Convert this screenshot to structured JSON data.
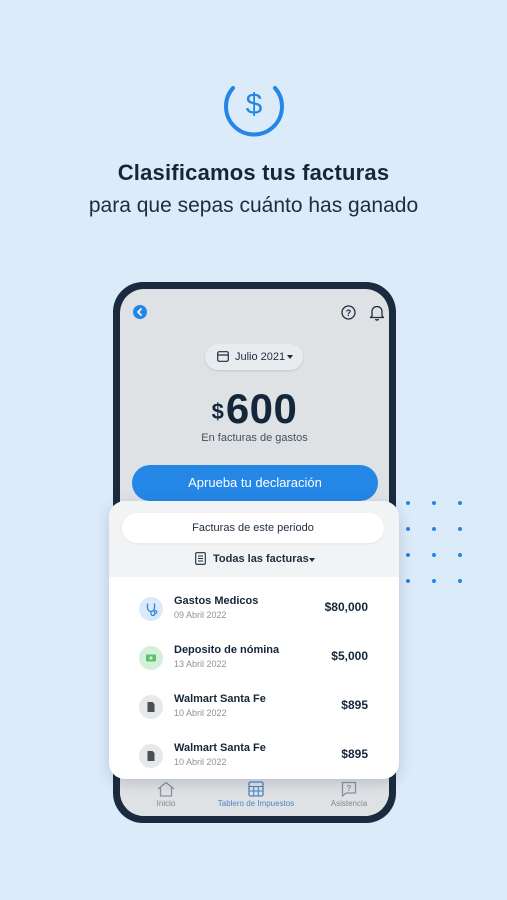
{
  "hero": {
    "icon": "dollar-circle-icon",
    "title": "Clasificamos tus facturas",
    "subtitle": "para que sepas cuánto has ganado"
  },
  "screen": {
    "period_label": "Julio 2021",
    "amount_currency": "$",
    "amount_value": "600",
    "amount_caption": "En facturas de gastos",
    "approve_button": "Aprueba tu declaración"
  },
  "card": {
    "title": "Facturas de este periodo",
    "filter_label": "Todas las facturas",
    "items": [
      {
        "name": "Gastos Medicos",
        "date": "09 Abril 2022",
        "amount": "$80,000",
        "icon": "stethoscope-icon",
        "icon_color": "#2487e6"
      },
      {
        "name": "Deposito de nómina",
        "date": "13 Abril 2022",
        "amount": "$5,000",
        "icon": "money-icon",
        "icon_color": "#5cc26a"
      },
      {
        "name": "Walmart Santa Fe",
        "date": "10 Abril 2022",
        "amount": "$895",
        "icon": "document-icon",
        "icon_color": "#4a4f55"
      },
      {
        "name": "Walmart Santa Fe",
        "date": "10 Abril 2022",
        "amount": "$895",
        "icon": "document-icon",
        "icon_color": "#4a4f55"
      }
    ]
  },
  "tabbar": {
    "tabs": [
      {
        "label": "Inicio",
        "icon": "home-icon",
        "active": false
      },
      {
        "label": "Tablero de Impuestos",
        "icon": "calculator-icon",
        "active": true
      },
      {
        "label": "Asistencia",
        "icon": "help-chat-icon",
        "active": false
      }
    ]
  },
  "colors": {
    "background": "#dcebfa",
    "accent": "#2487e6",
    "phone_frame": "#1b2a3f",
    "text_dark": "#14263a"
  }
}
